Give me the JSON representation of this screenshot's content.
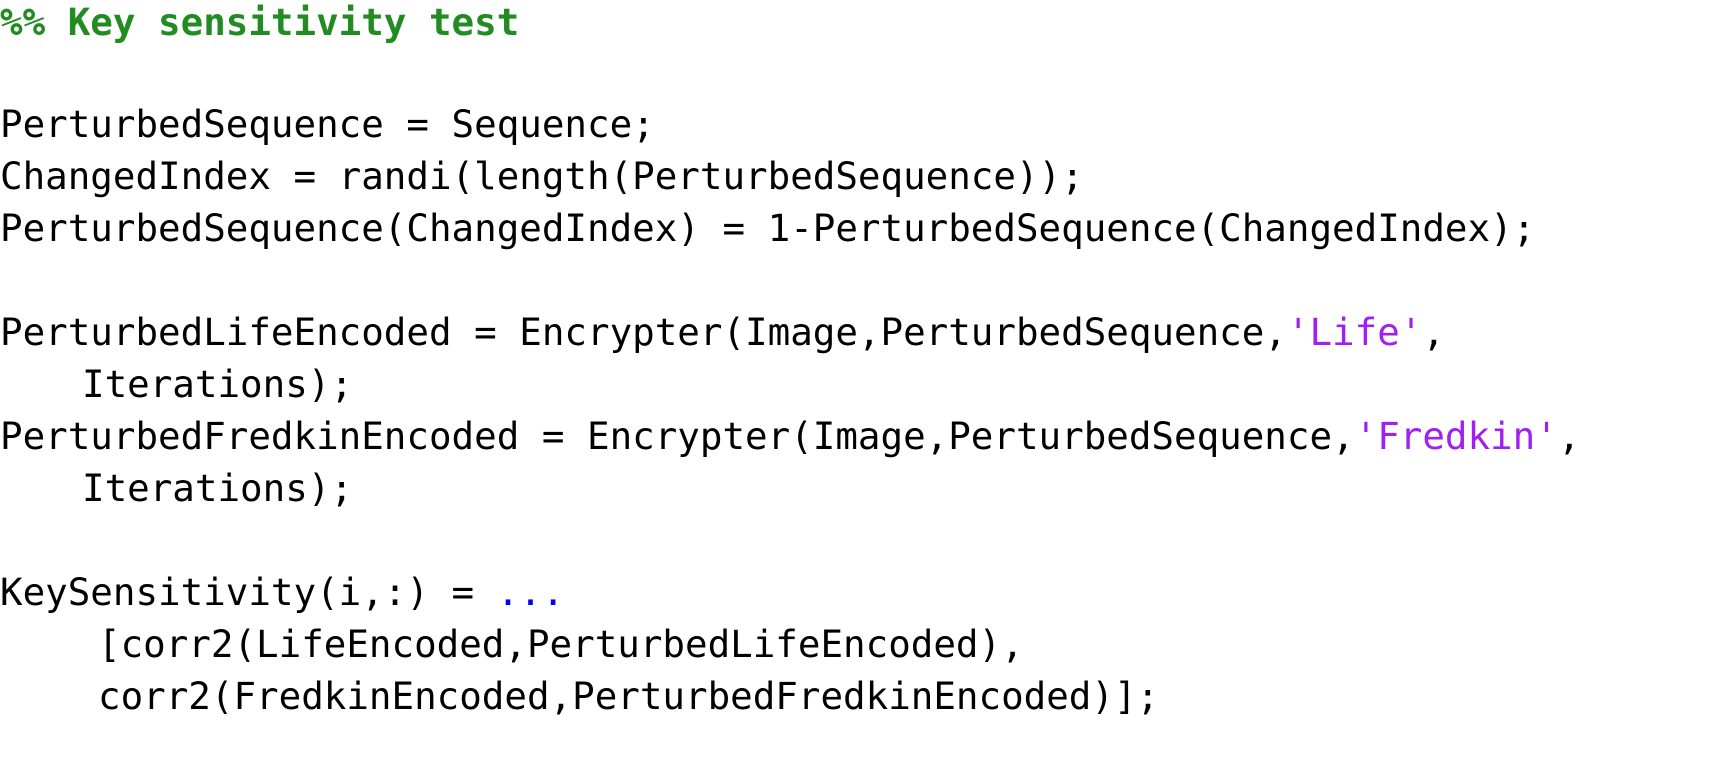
{
  "editor": {
    "colors": {
      "background": "#ffffff",
      "text": "#000000",
      "comment": "#228b22",
      "string": "#a020f0",
      "continuation": "#0000ff"
    },
    "lines": {
      "section_comment": "%% Key sensitivity test",
      "assign_perturbed": "PerturbedSequence = Sequence;",
      "changed_index": "ChangedIndex = randi(length(PerturbedSequence));",
      "flip_bit": "PerturbedSequence(ChangedIndex) = 1-PerturbedSequence(ChangedIndex);",
      "life_encoded_pre": "PerturbedLifeEncoded = Encrypter(Image,PerturbedSequence,",
      "life_encoded_str": "'Life'",
      "life_encoded_post": ",",
      "life_encoded_cont": "Iterations);",
      "fredkin_encoded_pre": "PerturbedFredkinEncoded = Encrypter(Image,PerturbedSequence,",
      "fredkin_encoded_str": "'Fredkin'",
      "fredkin_encoded_post": ",",
      "fredkin_encoded_cont": "Iterations);",
      "key_sens_pre": "KeySensitivity(i,:) = ",
      "key_sens_dots": "...",
      "corr_life": "[corr2(LifeEncoded,PerturbedLifeEncoded),",
      "corr_fredkin": "corr2(FredkinEncoded,PerturbedFredkinEncoded)];"
    }
  }
}
